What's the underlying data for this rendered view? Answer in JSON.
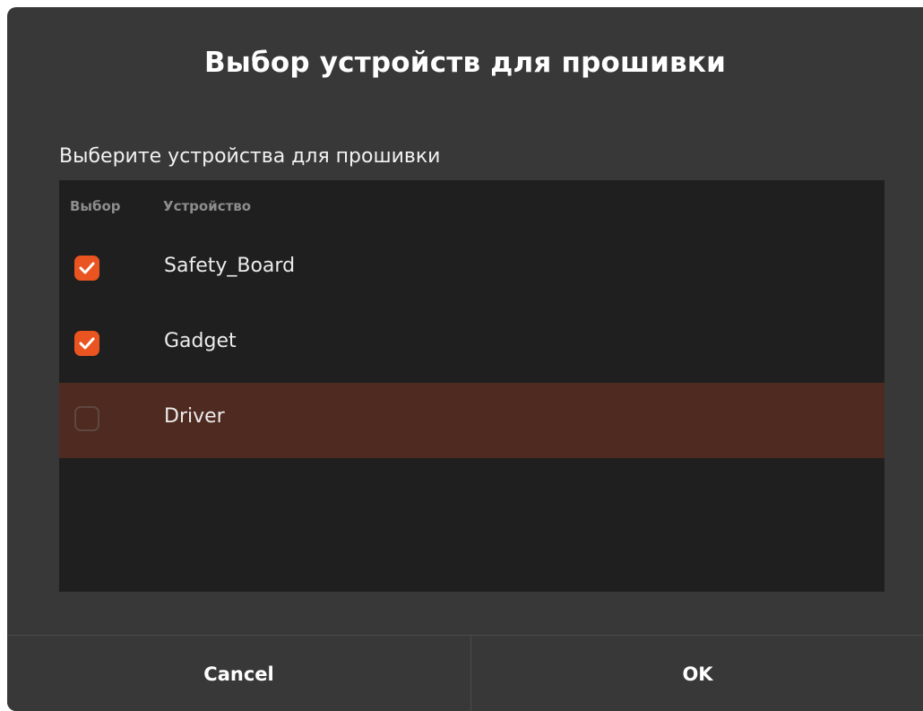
{
  "dialog": {
    "title": "Выбор устройств для прошивки",
    "subtitle": "Выберите устройства для прошивки"
  },
  "table": {
    "headers": {
      "select": "Выбор",
      "device": "Устройство"
    },
    "rows": [
      {
        "name": "Safety_Board",
        "checked": true,
        "selected": false
      },
      {
        "name": "Gadget",
        "checked": true,
        "selected": false
      },
      {
        "name": "Driver",
        "checked": false,
        "selected": true
      }
    ]
  },
  "buttons": {
    "cancel": "Cancel",
    "ok": "OK"
  },
  "colors": {
    "accent": "#e95420",
    "dialog_bg": "#383838",
    "list_bg": "#1f1f1f",
    "selected_row_bg": "#4f2a20"
  },
  "icons": {
    "checkbox_checked": "check-icon"
  }
}
